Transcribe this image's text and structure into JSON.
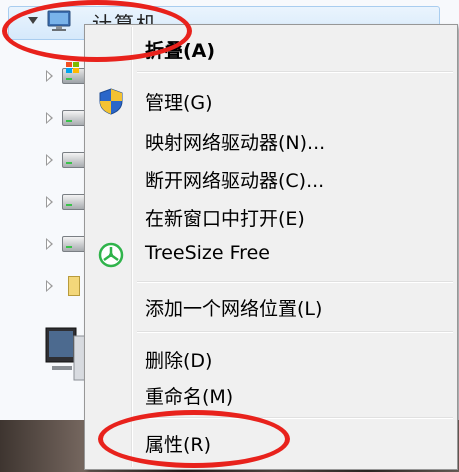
{
  "tree": {
    "root_label": "计算机"
  },
  "menu": {
    "items": [
      {
        "label": "折叠(A)",
        "bold": true
      },
      {
        "label": "管理(G)",
        "icon": "uac-shield-icon"
      },
      {
        "label": "映射网络驱动器(N)..."
      },
      {
        "label": "断开网络驱动器(C)..."
      },
      {
        "label": "在新窗口中打开(E)"
      },
      {
        "label": "TreeSize Free",
        "icon": "treesize-icon"
      },
      {
        "label": "添加一个网络位置(L)"
      },
      {
        "label": "删除(D)"
      },
      {
        "label": "重命名(M)"
      },
      {
        "label": "属性(R)"
      }
    ]
  },
  "colors": {
    "annotation": "#e8221c",
    "menu_bg": "#f0f0f0",
    "treesize_green": "#2fb34a"
  }
}
